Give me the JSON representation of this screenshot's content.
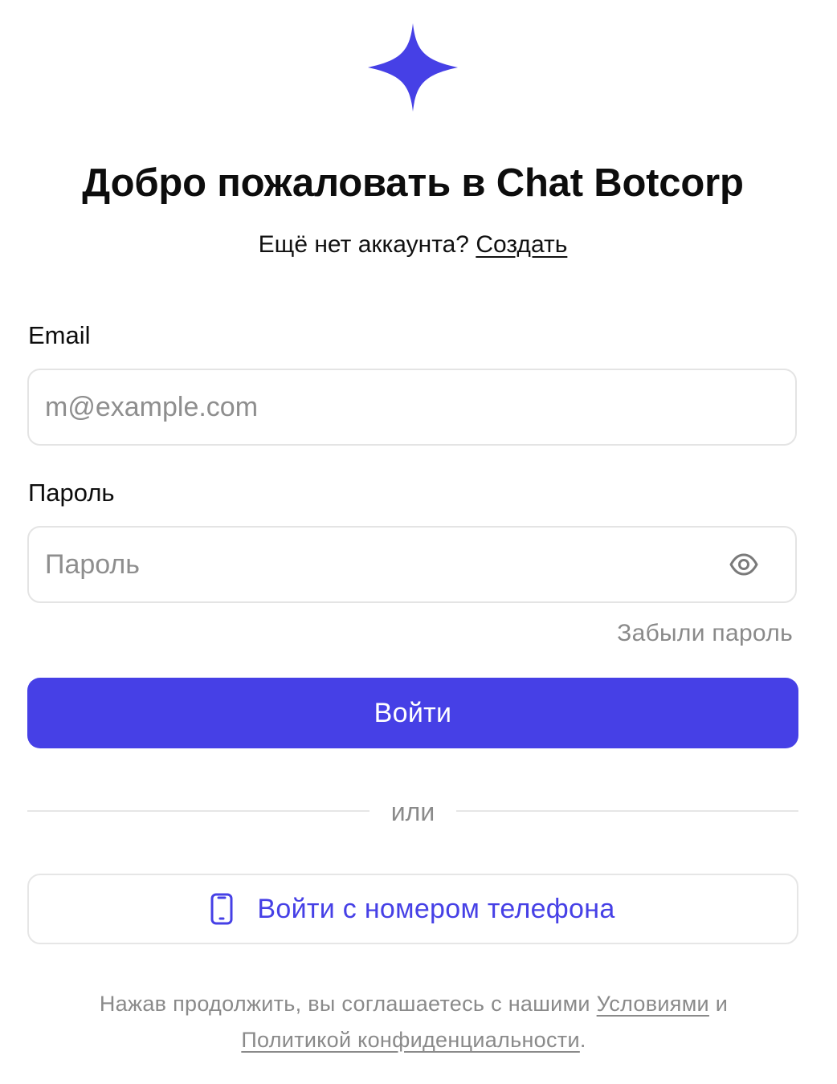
{
  "brand": {
    "logo_icon": "sparkle-star-icon",
    "accent_color": "#4640e6"
  },
  "header": {
    "title": "Добро пожаловать в Chat Botcorp",
    "signup_prompt": "Ещё нет аккаунта?",
    "signup_link": "Создать"
  },
  "form": {
    "email": {
      "label": "Email",
      "value": "",
      "placeholder": "m@example.com"
    },
    "password": {
      "label": "Пароль",
      "value": "",
      "placeholder": "Пароль",
      "toggle_icon": "eye-icon"
    },
    "forgot_password": "Забыли пароль",
    "submit_label": "Войти"
  },
  "divider": {
    "text": "или"
  },
  "phone_login": {
    "icon": "smartphone-icon",
    "label": "Войти с номером телефона"
  },
  "legal": {
    "prefix": "Нажав продолжить, вы соглашаетесь с нашими",
    "terms_link": "Условиями",
    "conjunction": "и",
    "privacy_link": "Политикой конфиденциальности",
    "suffix": "."
  }
}
